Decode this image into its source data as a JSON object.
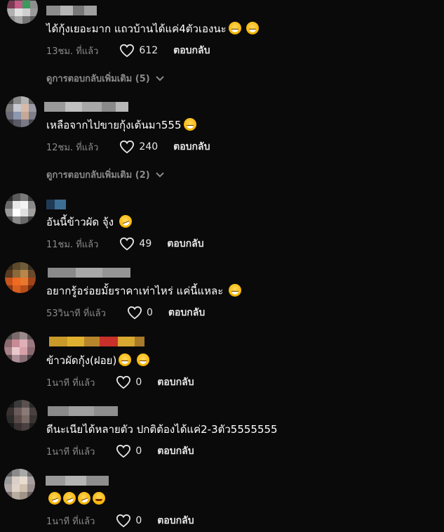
{
  "icons": {
    "like": "heart-outline-icon",
    "expand": "chevron-down-icon",
    "emoji_grin": "grinning-face-emoji",
    "emoji_laugh": "rolling-on-floor-laughing-emoji",
    "emoji_smile": "smiling-face-emoji"
  },
  "comments": [
    {
      "text": "ได้กุ้งเยอะมาก แถวบ้านได้แค่4ตัวเองนะ",
      "time": "13ชม. ที่แล้ว",
      "likes": "612",
      "reply_label": "ตอบกลับ",
      "view_more": "ดูการตอบกลับเพิ่มเติม (5)"
    },
    {
      "text": "เหลือจากไปขายกุ้งเต้นมา555",
      "time": "12ชม. ที่แล้ว",
      "likes": "240",
      "reply_label": "ตอบกลับ",
      "view_more": "ดูการตอบกลับเพิ่มเติม (2)"
    },
    {
      "text": "อันนี้ข้าวผัด จุ้ง",
      "time": "11ชม. ที่แล้ว",
      "likes": "49",
      "reply_label": "ตอบกลับ"
    },
    {
      "text": "อยากรู้อร่อยมั้ยราคาเท่าไหร่ แค่นี้แหละ",
      "time": "53วินาที ที่แล้ว",
      "likes": "0",
      "reply_label": "ตอบกลับ"
    },
    {
      "text": "ข้าวผัดกุ้ง(ฝอย)",
      "time": "1นาที ที่แล้ว",
      "likes": "0",
      "reply_label": "ตอบกลับ"
    },
    {
      "text": "ดีนะเนียได้หลายตัว ปกติต้องได้แค่2-3ตัว5555555",
      "time": "1นาที ที่แล้ว",
      "likes": "0",
      "reply_label": "ตอบกลับ"
    },
    {
      "text": "",
      "time": "1นาที ที่แล้ว",
      "likes": "0",
      "reply_label": "ตอบกลับ"
    }
  ]
}
